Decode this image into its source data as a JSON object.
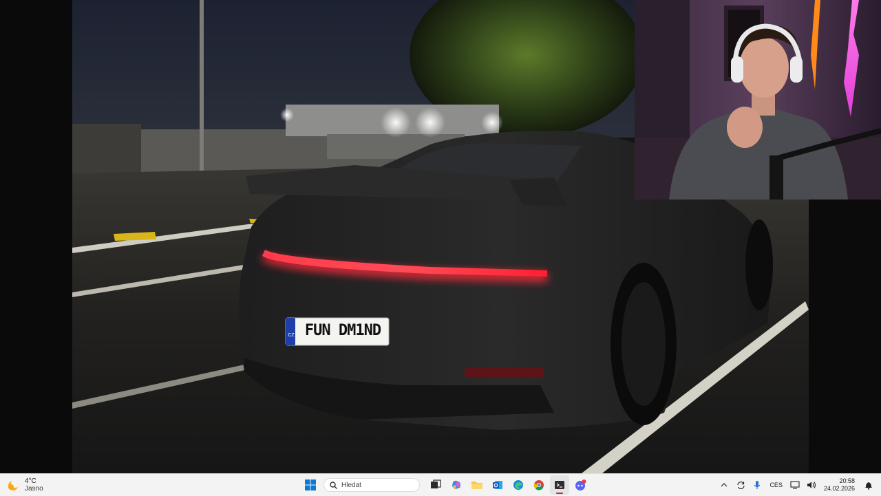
{
  "taskbar": {
    "weather": {
      "temperature": "4°C",
      "condition": "Jasno",
      "icon": "sun-moon-icon"
    },
    "start_icon": "windows-start-icon",
    "search": {
      "placeholder": "Hledat",
      "icon": "search-icon"
    },
    "apps": [
      {
        "name": "task-view",
        "icon": "task-view-icon"
      },
      {
        "name": "copilot",
        "icon": "copilot-icon"
      },
      {
        "name": "file-explorer",
        "icon": "folder-icon"
      },
      {
        "name": "outlook",
        "icon": "outlook-icon"
      },
      {
        "name": "edge",
        "icon": "edge-icon"
      },
      {
        "name": "chrome",
        "icon": "chrome-icon"
      },
      {
        "name": "terminal",
        "icon": "terminal-icon",
        "active": true
      },
      {
        "name": "discord",
        "icon": "discord-icon"
      }
    ],
    "tray": {
      "language": "CES",
      "time": "20:58",
      "date": "24.02.2026"
    }
  },
  "photo": {
    "license_plate_country": "CZ",
    "license_plate": "FUN DM1ND"
  },
  "colors": {
    "taskbar_bg": "#f3f3f3",
    "tail_light": "#ff2a3a",
    "accent": "#c42b1c"
  }
}
